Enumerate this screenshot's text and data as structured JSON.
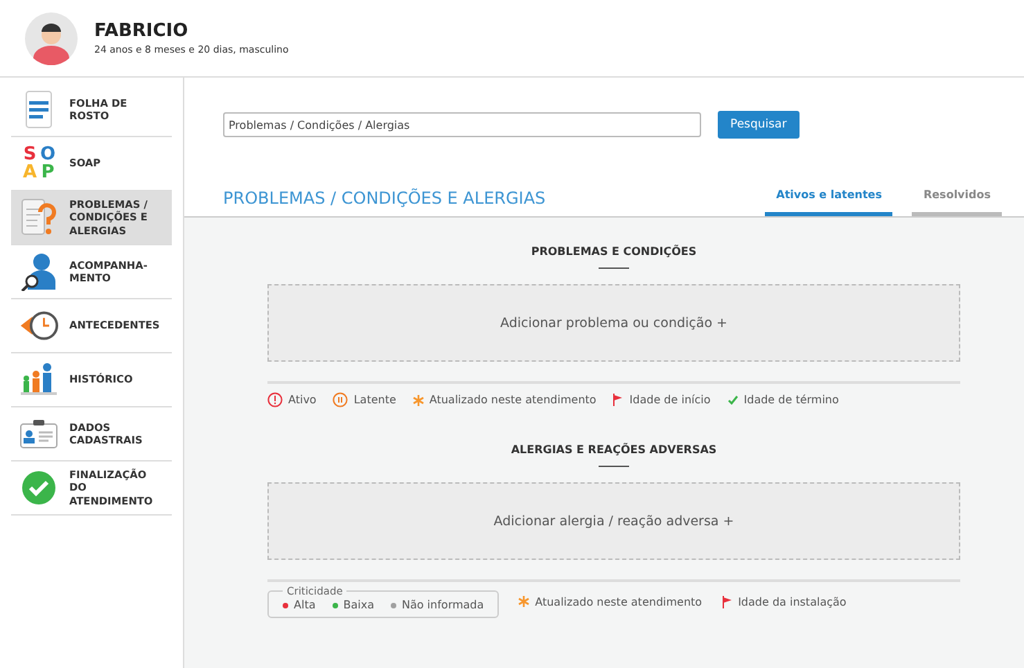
{
  "patient": {
    "name": "FABRICIO",
    "details": "24 anos e 8 meses e 20 dias, masculino"
  },
  "sidebar": {
    "items": [
      {
        "kind": "document",
        "label": "FOLHA DE ROSTO",
        "selected": false
      },
      {
        "kind": "soap",
        "label": "SOAP",
        "selected": false,
        "letters": [
          "S",
          "O",
          "A",
          "P"
        ]
      },
      {
        "kind": "question",
        "label": "PROBLEMAS / CONDIÇÕES E ALERGIAS",
        "selected": true
      },
      {
        "kind": "person",
        "label": "ACOMPANHA-MENTO",
        "selected": false
      },
      {
        "kind": "clock",
        "label": "ANTECEDENTES",
        "selected": false
      },
      {
        "kind": "family",
        "label": "HISTÓRICO",
        "selected": false
      },
      {
        "kind": "card",
        "label": "DADOS CADASTRAIS",
        "selected": false
      },
      {
        "kind": "check",
        "label": "FINALIZAÇÃO DO ATENDIMENTO",
        "selected": false
      }
    ]
  },
  "search": {
    "value": "Problemas / Condições / Alergias",
    "button": "Pesquisar"
  },
  "section_title": "PROBLEMAS / CONDIÇÕES E ALERGIAS",
  "tabs": [
    {
      "label": "Ativos e latentes",
      "selected": true
    },
    {
      "label": "Resolvidos",
      "selected": false
    }
  ],
  "problems": {
    "title": "PROBLEMAS E CONDIÇÕES",
    "add": "Adicionar problema ou condição +",
    "legend": [
      {
        "kind": "alert",
        "label": "Ativo"
      },
      {
        "kind": "pause",
        "label": "Latente"
      },
      {
        "kind": "star",
        "label": "Atualizado neste atendimento"
      },
      {
        "kind": "flag",
        "label": "Idade de início"
      },
      {
        "kind": "tick",
        "label": "Idade de término"
      }
    ]
  },
  "allergies": {
    "title": "ALERGIAS E REAÇÕES ADVERSAS",
    "add": "Adicionar alergia / reação adversa +",
    "criticality": {
      "title": "Criticidade",
      "levels": [
        {
          "label": "Alta",
          "color": "#e8303c"
        },
        {
          "label": "Baixa",
          "color": "#3bb54a"
        },
        {
          "label": "Não informada",
          "color": "#a0a0a0"
        }
      ]
    },
    "legend": [
      {
        "kind": "star",
        "label": "Atualizado neste atendimento"
      },
      {
        "kind": "flag",
        "label": "Idade da instalação"
      }
    ]
  }
}
